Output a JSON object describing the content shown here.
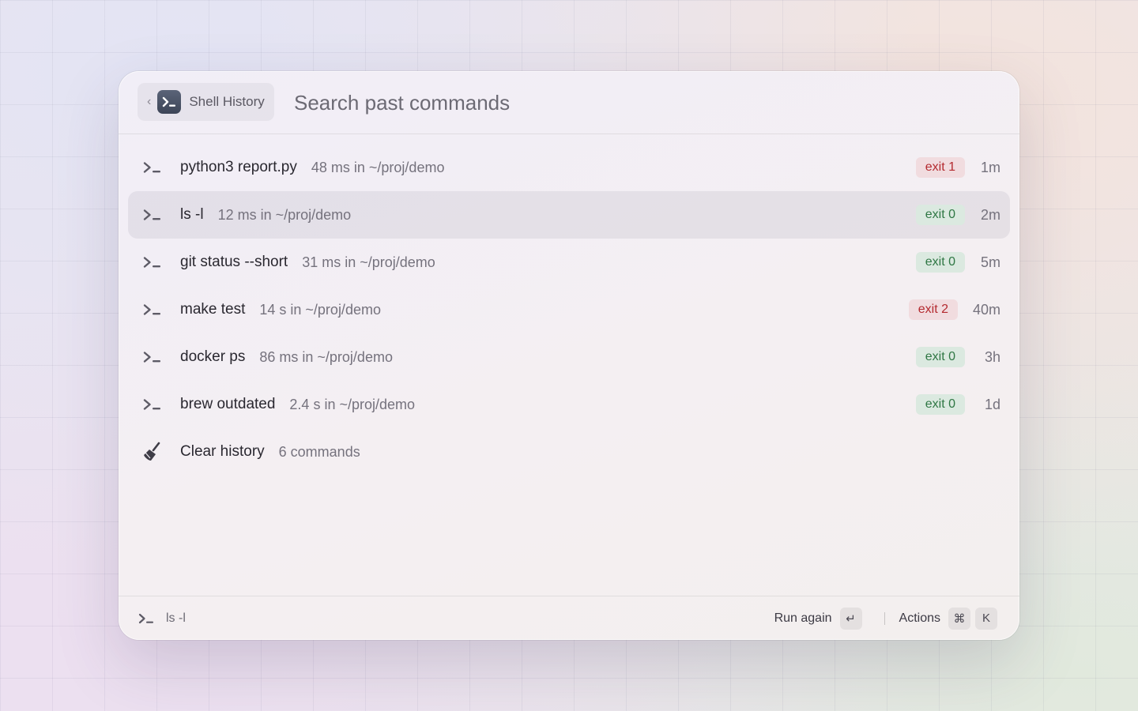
{
  "header": {
    "back_icon": "chevron-left-icon",
    "extension_icon": "terminal-icon",
    "extension_name": "Shell History",
    "search_placeholder": "Search past commands",
    "search_value": ""
  },
  "colors": {
    "exit_fail_bg": "#f1dcdf",
    "exit_fail_text": "#b42a2f",
    "exit_ok_bg": "#dbe9e0",
    "exit_ok_text": "#2f7744",
    "selected_row_bg": "#e4e0e8"
  },
  "list": {
    "items": [
      {
        "icon": "terminal-icon",
        "title": "python3 report.py",
        "subtitle": "48 ms in ~/proj/demo",
        "status": "exit 1",
        "status_kind": "fail",
        "age": "1m",
        "selected": false
      },
      {
        "icon": "terminal-icon",
        "title": "ls -l",
        "subtitle": "12 ms in ~/proj/demo",
        "status": "exit 0",
        "status_kind": "ok",
        "age": "2m",
        "selected": true
      },
      {
        "icon": "terminal-icon",
        "title": "git status --short",
        "subtitle": "31 ms in ~/proj/demo",
        "status": "exit 0",
        "status_kind": "ok",
        "age": "5m",
        "selected": false
      },
      {
        "icon": "terminal-icon",
        "title": "make test",
        "subtitle": "14 s in ~/proj/demo",
        "status": "exit 2",
        "status_kind": "fail",
        "age": "40m",
        "selected": false
      },
      {
        "icon": "terminal-icon",
        "title": "docker ps",
        "subtitle": "86 ms in ~/proj/demo",
        "status": "exit 0",
        "status_kind": "ok",
        "age": "3h",
        "selected": false
      },
      {
        "icon": "terminal-icon",
        "title": "brew outdated",
        "subtitle": "2.4 s in ~/proj/demo",
        "status": "exit 0",
        "status_kind": "ok",
        "age": "1d",
        "selected": false
      }
    ],
    "clear_item": {
      "icon": "broom-icon",
      "title": "Clear history",
      "subtitle": "6 commands"
    }
  },
  "footer": {
    "icon": "terminal-icon",
    "selected_label": "ls -l",
    "primary_action": "Run again",
    "primary_key": "↵",
    "actions_label": "Actions",
    "actions_keys": [
      "⌘",
      "K"
    ]
  }
}
